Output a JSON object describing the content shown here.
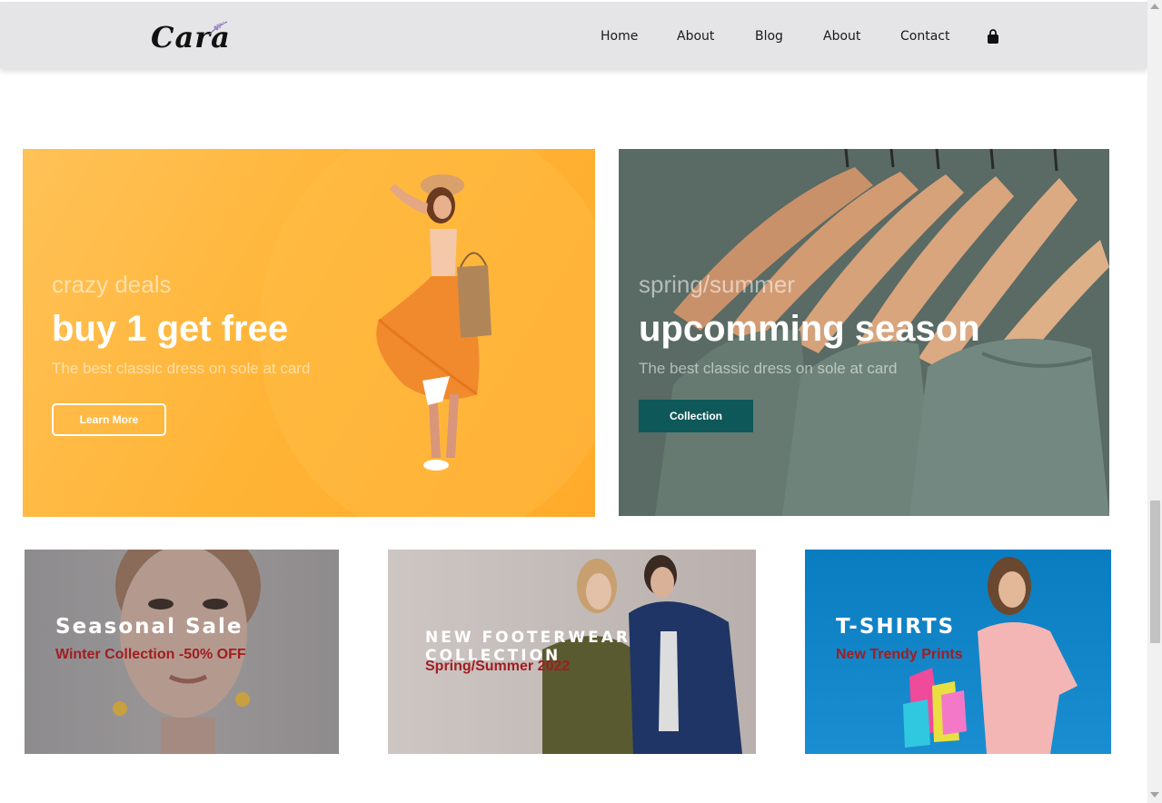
{
  "header": {
    "logo_text": "Cara",
    "nav": [
      "Home",
      "About",
      "Blog",
      "About",
      "Contact"
    ],
    "cart_icon": "shopping-bag-icon"
  },
  "banners": [
    {
      "subtitle": "crazy deals",
      "title": "buy 1 get free",
      "text": "The best classic dress on sole at card",
      "button": "Learn More",
      "background": "#ffb436"
    },
    {
      "subtitle": "spring/summer",
      "title": "upcomming season",
      "text": "The best classic dress on sole at card",
      "button": "Collection",
      "background": "#56675f",
      "button_color": "#0f5859"
    }
  ],
  "small_banners": [
    {
      "title": "Seasonal Sale",
      "text": "Winter Collection -50% OFF"
    },
    {
      "title": "NEW FOOTERWEAR COLLECTION",
      "text": "Spring/Summer 2022"
    },
    {
      "title": "T-SHIRTS",
      "text": "New Trendy Prints"
    }
  ],
  "colors": {
    "accent_text": "#a11d21",
    "header_bg": "#e5e5e7"
  }
}
